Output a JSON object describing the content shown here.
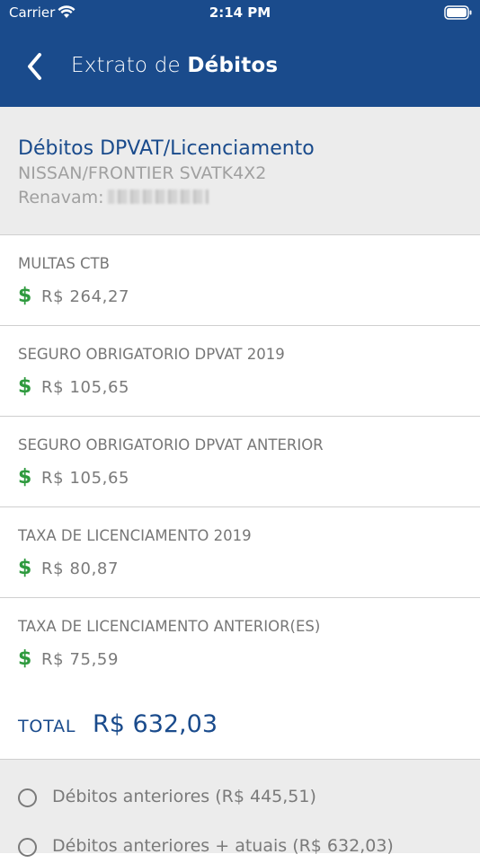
{
  "status_bar": {
    "carrier": "Carrier",
    "time": "2:14 PM",
    "wifi_icon": "wifi-icon",
    "battery_icon": "battery-icon"
  },
  "nav": {
    "back_icon": "chevron-left-icon",
    "title_prefix": "Extrato de",
    "title_bold": "Débitos"
  },
  "vehicle": {
    "title": "Débitos DPVAT/Licenciamento",
    "model": "NISSAN/FRONTIER SVATK4X2",
    "renavam_label": "Renavam:"
  },
  "debts": [
    {
      "label": "MULTAS CTB",
      "value": "R$ 264,27"
    },
    {
      "label": "SEGURO OBRIGATORIO DPVAT 2019",
      "value": "R$ 105,65"
    },
    {
      "label": "SEGURO OBRIGATORIO DPVAT ANTERIOR",
      "value": "R$ 105,65"
    },
    {
      "label": "TAXA DE LICENCIAMENTO 2019",
      "value": "R$ 80,87"
    },
    {
      "label": "TAXA DE LICENCIAMENTO ANTERIOR(ES)",
      "value": "R$ 75,59"
    }
  ],
  "total": {
    "label": "TOTAL",
    "value": "R$ 632,03"
  },
  "options": [
    {
      "label": "Débitos anteriores (R$ 445,51)",
      "selected": false
    },
    {
      "label": "Débitos anteriores + atuais (R$ 632,03)",
      "selected": false
    }
  ],
  "colors": {
    "primary": "#1a4b8c",
    "money_icon": "#2e9a3e",
    "background_gray": "#ececec"
  }
}
